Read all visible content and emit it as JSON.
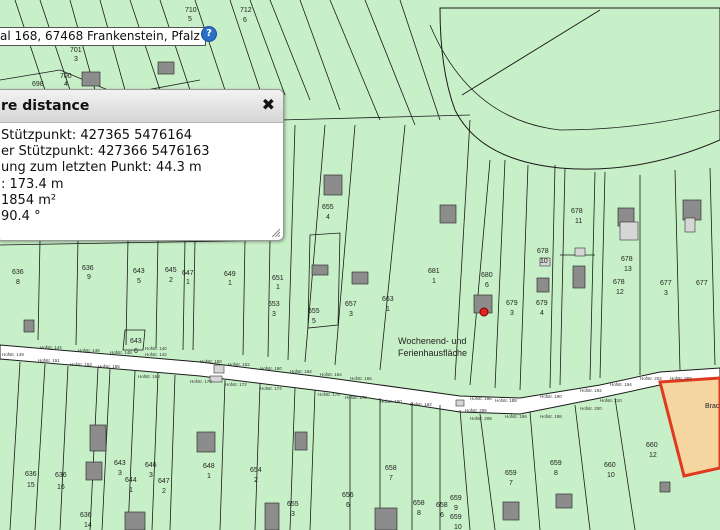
{
  "address": "al 168, 67468 Frankenstein, Pfalz",
  "help_icon": "?",
  "measure_panel": {
    "title": "re distance",
    "close_glyph": "✖",
    "lines": [
      "Stützpunkt: 427365 5476164",
      "er Stützpunkt: 427366 5476163",
      "ung zum letzten Punkt: 44.3 m",
      ": 173.4 m",
      "1854 m²",
      "90.4 °"
    ]
  },
  "map": {
    "colors": {
      "parcel_fill": "#c8f0c8",
      "parcel_line": "#1a1a1a",
      "building": "#8c8c8c",
      "highlight_fill": "#f5d6a0",
      "highlight_border": "#e03a1e",
      "road": "#ffffff",
      "marker": "#e52222"
    },
    "area_labels": [
      "Wochenend- und",
      "Ferienhausfläche"
    ],
    "highlight_label_1": "Brac",
    "parcels": [
      {
        "num": "710",
        "sub": "5"
      },
      {
        "num": "712",
        "sub": "6"
      },
      {
        "num": "701",
        "sub": "3"
      },
      {
        "num": "700",
        "sub": "4"
      },
      {
        "num": "698",
        "sub": ""
      },
      {
        "num": "655",
        "sub": "4"
      },
      {
        "num": "636",
        "sub": "8"
      },
      {
        "num": "636",
        "sub": "9"
      },
      {
        "num": "643",
        "sub": "5"
      },
      {
        "num": "645",
        "sub": "2"
      },
      {
        "num": "647",
        "sub": "1"
      },
      {
        "num": "649",
        "sub": "1"
      },
      {
        "num": "651",
        "sub": "1"
      },
      {
        "num": "653",
        "sub": "3"
      },
      {
        "num": "655",
        "sub": "5"
      },
      {
        "num": "657",
        "sub": "3"
      },
      {
        "num": "663",
        "sub": "1"
      },
      {
        "num": "681",
        "sub": "1"
      },
      {
        "num": "680",
        "sub": "6"
      },
      {
        "num": "679",
        "sub": "3"
      },
      {
        "num": "679",
        "sub": "4"
      },
      {
        "num": "678",
        "sub": "10"
      },
      {
        "num": "678",
        "sub": "11"
      },
      {
        "num": "678",
        "sub": "12"
      },
      {
        "num": "678",
        "sub": "13"
      },
      {
        "num": "677",
        "sub": "3"
      },
      {
        "num": "677",
        "sub": ""
      },
      {
        "num": "643",
        "sub": "6"
      },
      {
        "num": "636",
        "sub": "15"
      },
      {
        "num": "636",
        "sub": "16"
      },
      {
        "num": "643",
        "sub": "3"
      },
      {
        "num": "644",
        "sub": "1"
      },
      {
        "num": "646",
        "sub": "3"
      },
      {
        "num": "647",
        "sub": "2"
      },
      {
        "num": "648",
        "sub": "1"
      },
      {
        "num": "654",
        "sub": "2"
      },
      {
        "num": "655",
        "sub": "3"
      },
      {
        "num": "656",
        "sub": "6"
      },
      {
        "num": "658",
        "sub": "7"
      },
      {
        "num": "658",
        "sub": "8"
      },
      {
        "num": "659",
        "sub": "9"
      },
      {
        "num": "659",
        "sub": "7"
      },
      {
        "num": "659",
        "sub": "8"
      },
      {
        "num": "660",
        "sub": "10"
      },
      {
        "num": "660",
        "sub": "12"
      },
      {
        "num": "636",
        "sub": "14"
      },
      {
        "num": "658",
        "sub": "6"
      },
      {
        "num": "659",
        "sub": "10"
      }
    ],
    "street_labels": [
      "Hofstr. 149",
      "Hofstr. 151",
      "Hofstr. 153",
      "Hofstr. 155",
      "Hofstr. 140",
      "Hofstr. 142",
      "Hofstr. 144",
      "Hofstr. 146",
      "Hofstr. 148",
      "Hofstr. 150",
      "Hofstr. 152",
      "Hofstr. 160",
      "Hofstr. 162",
      "Hofstr. 164",
      "Hofstr. 166",
      "Hofstr. 168",
      "Hofstr. 170",
      "Hofstr. 172",
      "Hofstr. 174",
      "Hofstr. 176",
      "Hofstr. 178",
      "Hofstr. 180",
      "Hofstr. 182",
      "Hofstr. 186",
      "Hofstr. 188",
      "Hofstr. 190",
      "Hofstr. 192",
      "Hofstr. 194",
      "Hofstr. 196",
      "Hofstr. 198",
      "Hofstr. 200",
      "Hofstr. 202",
      "Hofstr. 204",
      "Hofstr. 206",
      "Hofstr. 208",
      "Hofstr. 210"
    ]
  }
}
